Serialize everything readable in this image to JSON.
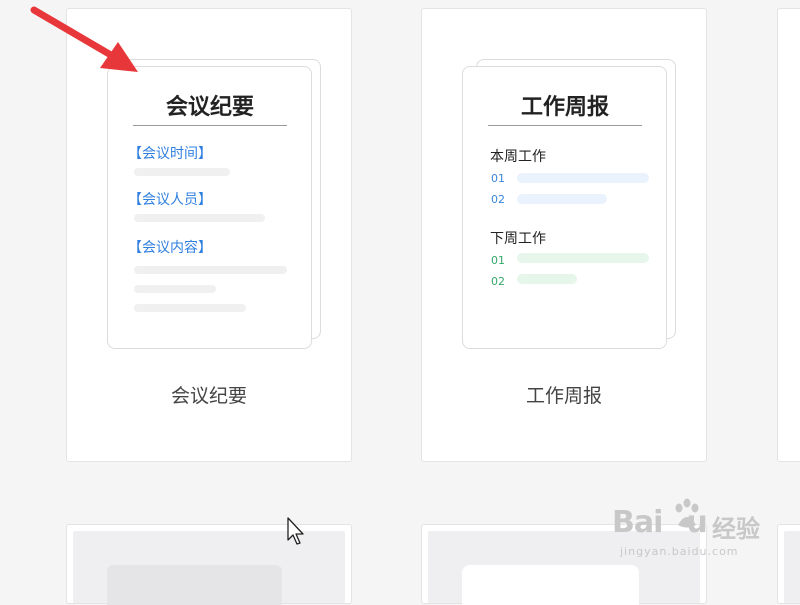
{
  "cards": [
    {
      "label": "会议纪要",
      "doc_title": "会议纪要",
      "sections": [
        "【会议时间】",
        "【会议人员】",
        "【会议内容】"
      ]
    },
    {
      "label": "工作周报",
      "doc_title": "工作周报",
      "groups": [
        {
          "heading": "本周工作",
          "items": [
            "01",
            "02"
          ],
          "color": "#3a86d9"
        },
        {
          "heading": "下周工作",
          "items": [
            "01",
            "02"
          ],
          "color": "#35a86a"
        }
      ]
    }
  ],
  "watermark": {
    "brand": "Bai",
    "brand_tail": "u",
    "cn": "经验",
    "url": "jingyan.baidu.com"
  },
  "colors": {
    "accent_blue": "#2f7fe0",
    "accent_green": "#35a86a",
    "arrow_red": "#e8373a"
  }
}
